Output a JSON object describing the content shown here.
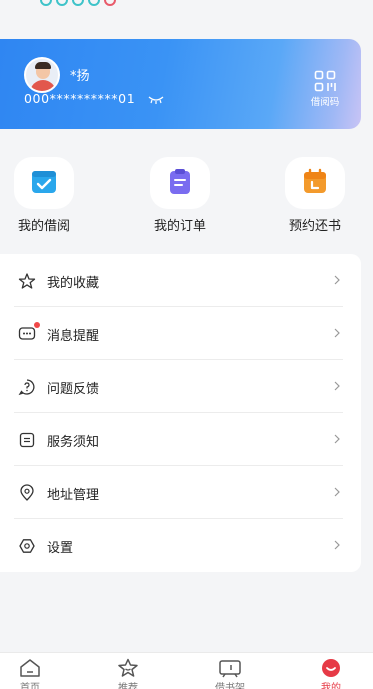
{
  "user": {
    "name": "*扬",
    "card_number": "000**********01"
  },
  "card": {
    "qr_label": "借阅码"
  },
  "quick_actions": [
    {
      "label": "我的借阅",
      "icon": "check-window-icon",
      "color": "#2aa7ec"
    },
    {
      "label": "我的订单",
      "icon": "clipboard-icon",
      "color": "#7a6cf0"
    },
    {
      "label": "预约还书",
      "icon": "calendar-icon",
      "color": "#f39a2c"
    }
  ],
  "menu": [
    {
      "label": "我的收藏",
      "icon": "star-icon"
    },
    {
      "label": "消息提醒",
      "icon": "message-icon",
      "has_badge": true
    },
    {
      "label": "问题反馈",
      "icon": "question-icon"
    },
    {
      "label": "服务须知",
      "icon": "notice-icon"
    },
    {
      "label": "地址管理",
      "icon": "location-icon"
    },
    {
      "label": "设置",
      "icon": "settings-icon"
    }
  ],
  "tabbar": {
    "items": [
      {
        "label": "首页",
        "icon": "home-icon"
      },
      {
        "label": "推荐",
        "icon": "recommend-icon"
      },
      {
        "label": "借书架",
        "icon": "bookshelf-icon"
      },
      {
        "label": "我的",
        "icon": "profile-icon",
        "active": true
      }
    ],
    "active_color": "#e63a46"
  }
}
